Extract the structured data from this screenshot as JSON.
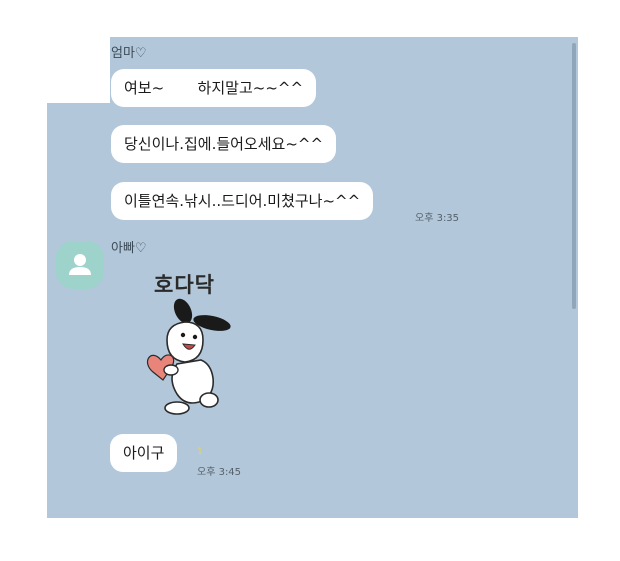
{
  "chat": {
    "background_color": "#b2c7da",
    "groups": [
      {
        "sender": "엄마♡",
        "messages": [
          "여보~       하지말고~~^^",
          "당신이나.집에.들어오세요~^^",
          "이틀연속.낚시..드디어.미쳤구나~^^"
        ],
        "time": "오후 3:35"
      },
      {
        "sender": "아빠♡",
        "avatar_icon": "person-icon",
        "sticker_text": "호다닥",
        "sticker_icon": "rabbit-holding-heart-sticker",
        "messages": [
          "아이구"
        ],
        "read_mark": "1",
        "time": "오후 3:45"
      }
    ]
  }
}
